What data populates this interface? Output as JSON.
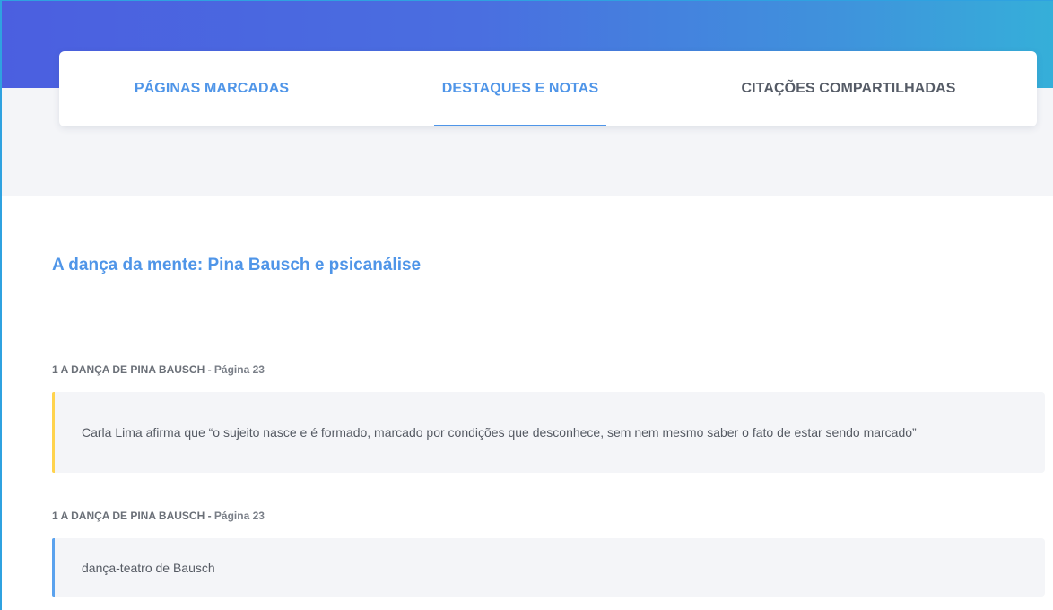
{
  "tabs": [
    {
      "label": "PÁGINAS MARCADAS",
      "active": false
    },
    {
      "label": "DESTAQUES E NOTAS",
      "active": true
    },
    {
      "label": "CITAÇÕES COMPARTILHADAS",
      "active": false
    }
  ],
  "book": {
    "title": "A dança da mente: Pina Bausch e psicanálise"
  },
  "entries": [
    {
      "chapter": "1 A DANÇA DE PINA BAUSCH",
      "separator": " - ",
      "page": "Página 23",
      "type": "highlight",
      "stripe_color": "#ffd34d",
      "text": "Carla Lima afirma que “o sujeito nasce e é formado, marcado por condições que desconhece, sem nem mesmo saber o fato de estar sendo marcado”"
    },
    {
      "chapter": "1 A DANÇA DE PINA BAUSCH",
      "separator": " - ",
      "page": "Página 23",
      "type": "note",
      "stripe_color": "#5aa2ee",
      "text": "dança-teatro de Bausch"
    }
  ],
  "colors": {
    "accent": "#4f95e8",
    "header_gradient_start": "#4b5fe0",
    "header_gradient_end": "#35afd9",
    "card_background": "#f4f5f8"
  }
}
